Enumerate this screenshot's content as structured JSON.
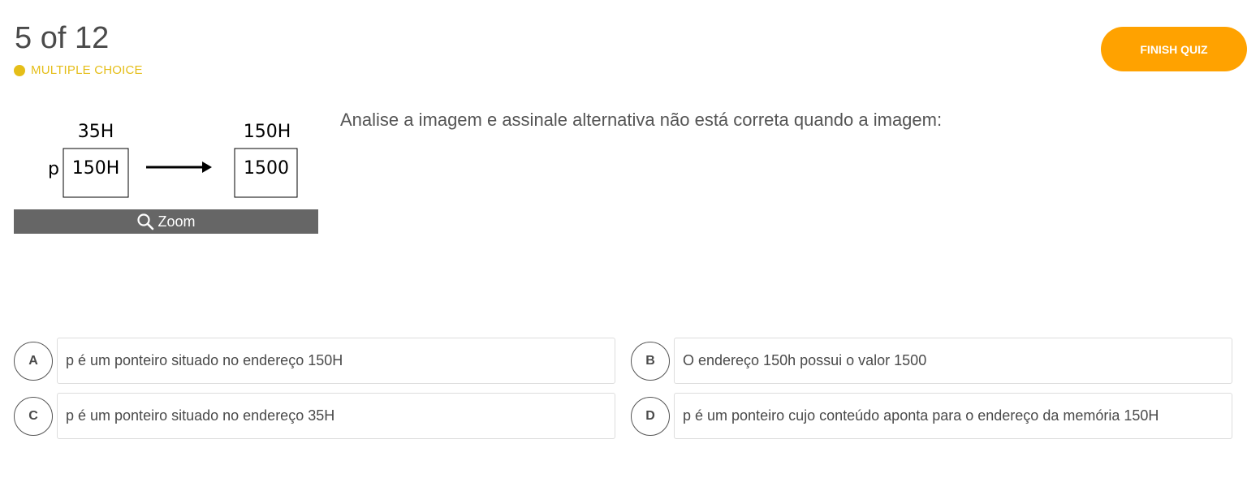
{
  "header": {
    "progress": "5 of 12",
    "question_type": "MULTIPLE CHOICE",
    "finish_label": "FINISH QUIZ"
  },
  "image": {
    "label_left_top": "35H",
    "label_right_top": "150H",
    "pointer_name": "p",
    "left_box_value": "150H",
    "right_box_value": "1500",
    "zoom_label": "Zoom"
  },
  "question": {
    "text": "Analise a imagem e assinale alternativa não está correta quando a imagem:"
  },
  "options": [
    {
      "letter": "A",
      "text": "p é um ponteiro situado no endereço 150H"
    },
    {
      "letter": "B",
      "text": "O endereço 150h possui o valor 1500"
    },
    {
      "letter": "C",
      "text": "p é um ponteiro situado no endereço 35H"
    },
    {
      "letter": "D",
      "text": "p é um ponteiro cujo conteúdo aponta para o endereço da memória 150H"
    }
  ],
  "colors": {
    "accent": "#ffa200",
    "type_badge": "#e5be18",
    "zoom_bar": "#666666"
  }
}
